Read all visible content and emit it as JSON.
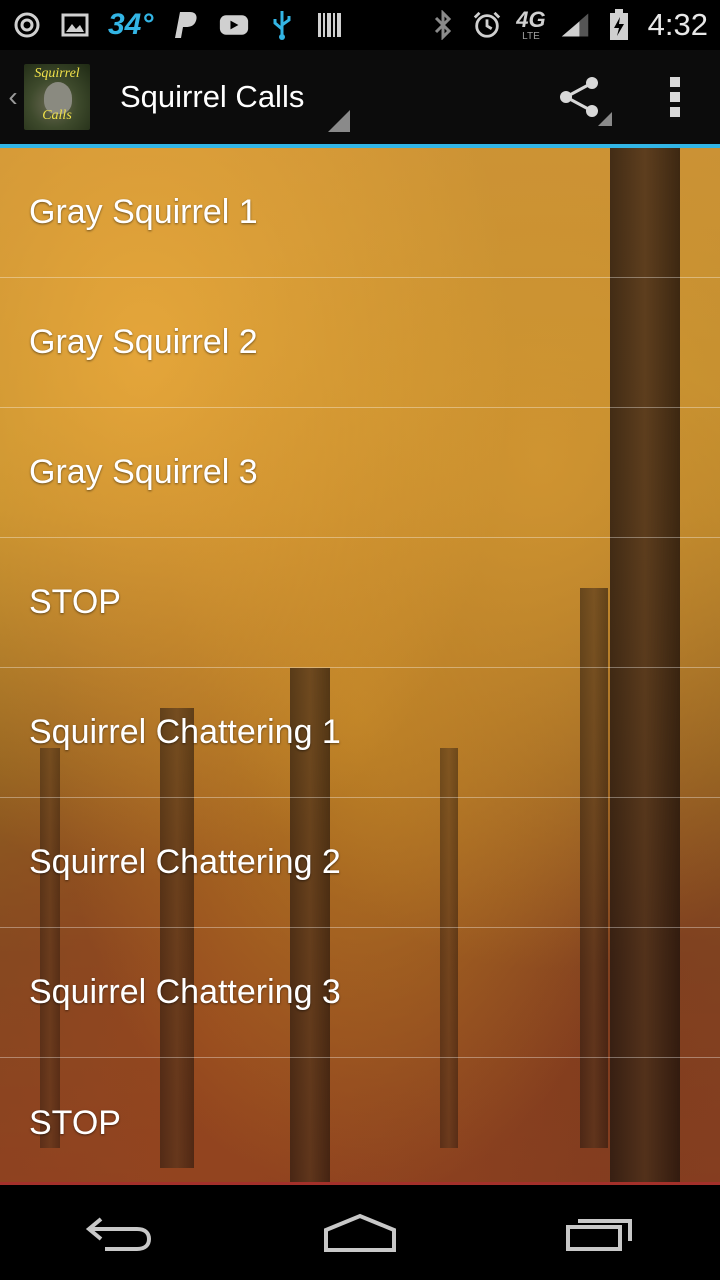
{
  "status_bar": {
    "temperature": "34°",
    "network": "4G",
    "network_sub": "LTE",
    "time": "4:32",
    "icons": [
      "sync-icon",
      "image-icon",
      "paypal-icon",
      "youtube-icon",
      "usb-icon",
      "barcode-icon",
      "bluetooth-icon",
      "alarm-icon",
      "signal-icon",
      "battery-charging-icon"
    ]
  },
  "action_bar": {
    "app_icon_line1": "Squirrel",
    "app_icon_line2": "Calls",
    "title": "Squirrel Calls",
    "accent_color": "#33b5e5"
  },
  "list": {
    "items": [
      {
        "label": "Gray Squirrel 1"
      },
      {
        "label": "Gray Squirrel 2"
      },
      {
        "label": "Gray Squirrel 3"
      },
      {
        "label": "STOP"
      },
      {
        "label": "Squirrel Chattering 1"
      },
      {
        "label": "Squirrel Chattering 2"
      },
      {
        "label": "Squirrel Chattering 3"
      },
      {
        "label": "STOP"
      }
    ]
  },
  "nav_bar": {
    "buttons": [
      "back-icon",
      "home-icon",
      "recent-apps-icon"
    ]
  }
}
